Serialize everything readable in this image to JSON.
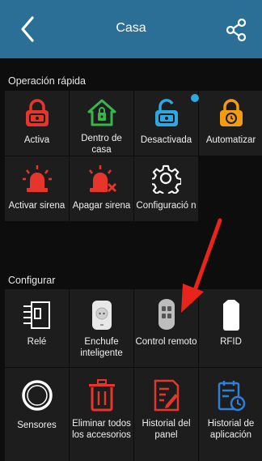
{
  "header": {
    "title": "Casa",
    "back_icon": "chevron-left-icon",
    "share_icon": "share-icon"
  },
  "quick": {
    "section_title": "Operación rápida",
    "items": [
      {
        "label": "Activa",
        "icon": "lock-closed-icon",
        "color": "#e6362c"
      },
      {
        "label": "Dentro de casa",
        "icon": "home-lock-icon",
        "color": "#39b54a"
      },
      {
        "label": "Desactivada",
        "icon": "lock-open-icon",
        "color": "#2fa7e0",
        "badge": true
      },
      {
        "label": "Automatizar",
        "icon": "lock-timer-icon",
        "color": "#f39c12"
      },
      {
        "label": "Activar sirena",
        "icon": "siren-icon",
        "color": "#e6362c"
      },
      {
        "label": "Apagar sirena",
        "icon": "siren-off-icon",
        "color": "#e6362c"
      },
      {
        "label": "Configuració n",
        "icon": "gear-icon",
        "color": "#ffffff"
      }
    ]
  },
  "config": {
    "section_title": "Configurar",
    "items": [
      {
        "label": "Relé",
        "icon": "relay-icon"
      },
      {
        "label": "Enchufe inteligente",
        "icon": "smart-plug-icon"
      },
      {
        "label": "Control remoto",
        "icon": "remote-control-icon"
      },
      {
        "label": "RFID",
        "icon": "rfid-tag-icon"
      },
      {
        "label": "Sensores",
        "icon": "sensor-ring-icon"
      },
      {
        "label": "Eliminar todos los accesorios",
        "icon": "trash-icon"
      },
      {
        "label": "Historial del panel",
        "icon": "panel-history-icon"
      },
      {
        "label": "Historial de aplicación",
        "icon": "app-history-icon"
      }
    ]
  },
  "annotation": {
    "arrow_color": "#e8241c",
    "arrow_icon": "red-arrow-icon"
  }
}
